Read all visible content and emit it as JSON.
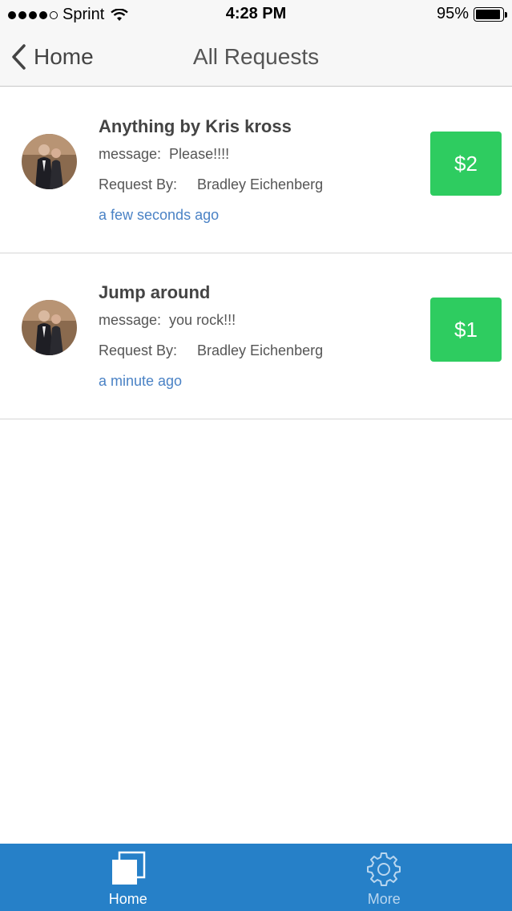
{
  "status_bar": {
    "carrier": "Sprint",
    "time": "4:28 PM",
    "battery_percent": "95%",
    "battery_level": 0.95,
    "signal_bars_filled": 4,
    "signal_bars_total": 5
  },
  "nav": {
    "back_label": "Home",
    "title": "All Requests"
  },
  "requests": [
    {
      "title": "Anything by Kris kross",
      "message": "message:  Please!!!!",
      "requested_by_label": "Request By:",
      "requested_by": "Bradley Eichenberg",
      "time": "a few seconds ago",
      "price": "$2"
    },
    {
      "title": "Jump around",
      "message": "message:  you rock!!!",
      "requested_by_label": "Request By:",
      "requested_by": "Bradley Eichenberg",
      "time": "a minute ago",
      "price": "$1"
    }
  ],
  "tabs": [
    {
      "label": "Home",
      "icon": "home-squares-icon",
      "active": true
    },
    {
      "label": "More",
      "icon": "gear-icon",
      "active": false
    }
  ],
  "colors": {
    "price_button": "#2ecc60",
    "timestamp": "#4a82c5",
    "tab_bar": "#2680c8"
  }
}
